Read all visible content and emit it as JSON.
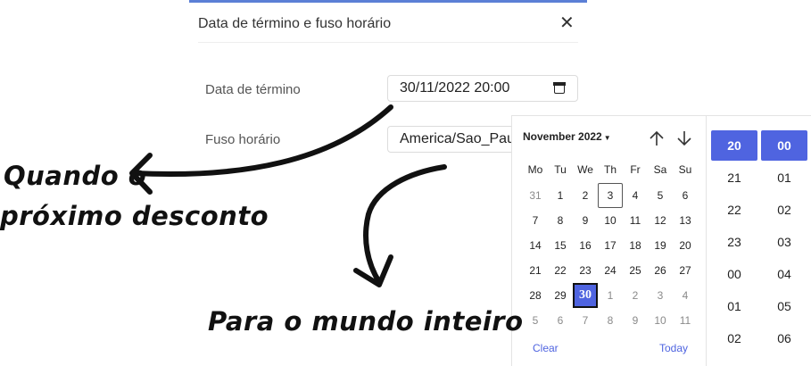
{
  "dialog": {
    "title": "Data de término e fuso horário",
    "close_icon": "close-icon"
  },
  "form": {
    "end_date_label": "Data de término",
    "end_date_value": "30/11/2022 20:00",
    "timezone_label": "Fuso horário",
    "timezone_value": "America/Sao_Paulo"
  },
  "picker": {
    "month_label": "November 2022",
    "weekdays": [
      "Mo",
      "Tu",
      "We",
      "Th",
      "Fr",
      "Sa",
      "Su"
    ],
    "weeks": [
      [
        "31",
        "1",
        "2",
        "3",
        "4",
        "5",
        "6"
      ],
      [
        "7",
        "8",
        "9",
        "10",
        "11",
        "12",
        "13"
      ],
      [
        "14",
        "15",
        "16",
        "17",
        "18",
        "19",
        "20"
      ],
      [
        "21",
        "22",
        "23",
        "24",
        "25",
        "26",
        "27"
      ],
      [
        "28",
        "29",
        "30",
        "1",
        "2",
        "3",
        "4"
      ],
      [
        "5",
        "6",
        "7",
        "8",
        "9",
        "10",
        "11"
      ]
    ],
    "today_day": "3",
    "selected_day": "30",
    "clear_label": "Clear",
    "today_label": "Today",
    "hours": [
      "20",
      "21",
      "22",
      "23",
      "00",
      "01",
      "02"
    ],
    "minutes": [
      "00",
      "01",
      "02",
      "03",
      "04",
      "05",
      "06"
    ],
    "selected_hour": "20",
    "selected_minute": "00"
  },
  "annotations": {
    "line1": "Quando o",
    "line2": "próximo desconto",
    "line3": "Para o mundo inteiro"
  },
  "colors": {
    "accent": "#4f64e0",
    "top_bar": "#5b7fd6"
  }
}
